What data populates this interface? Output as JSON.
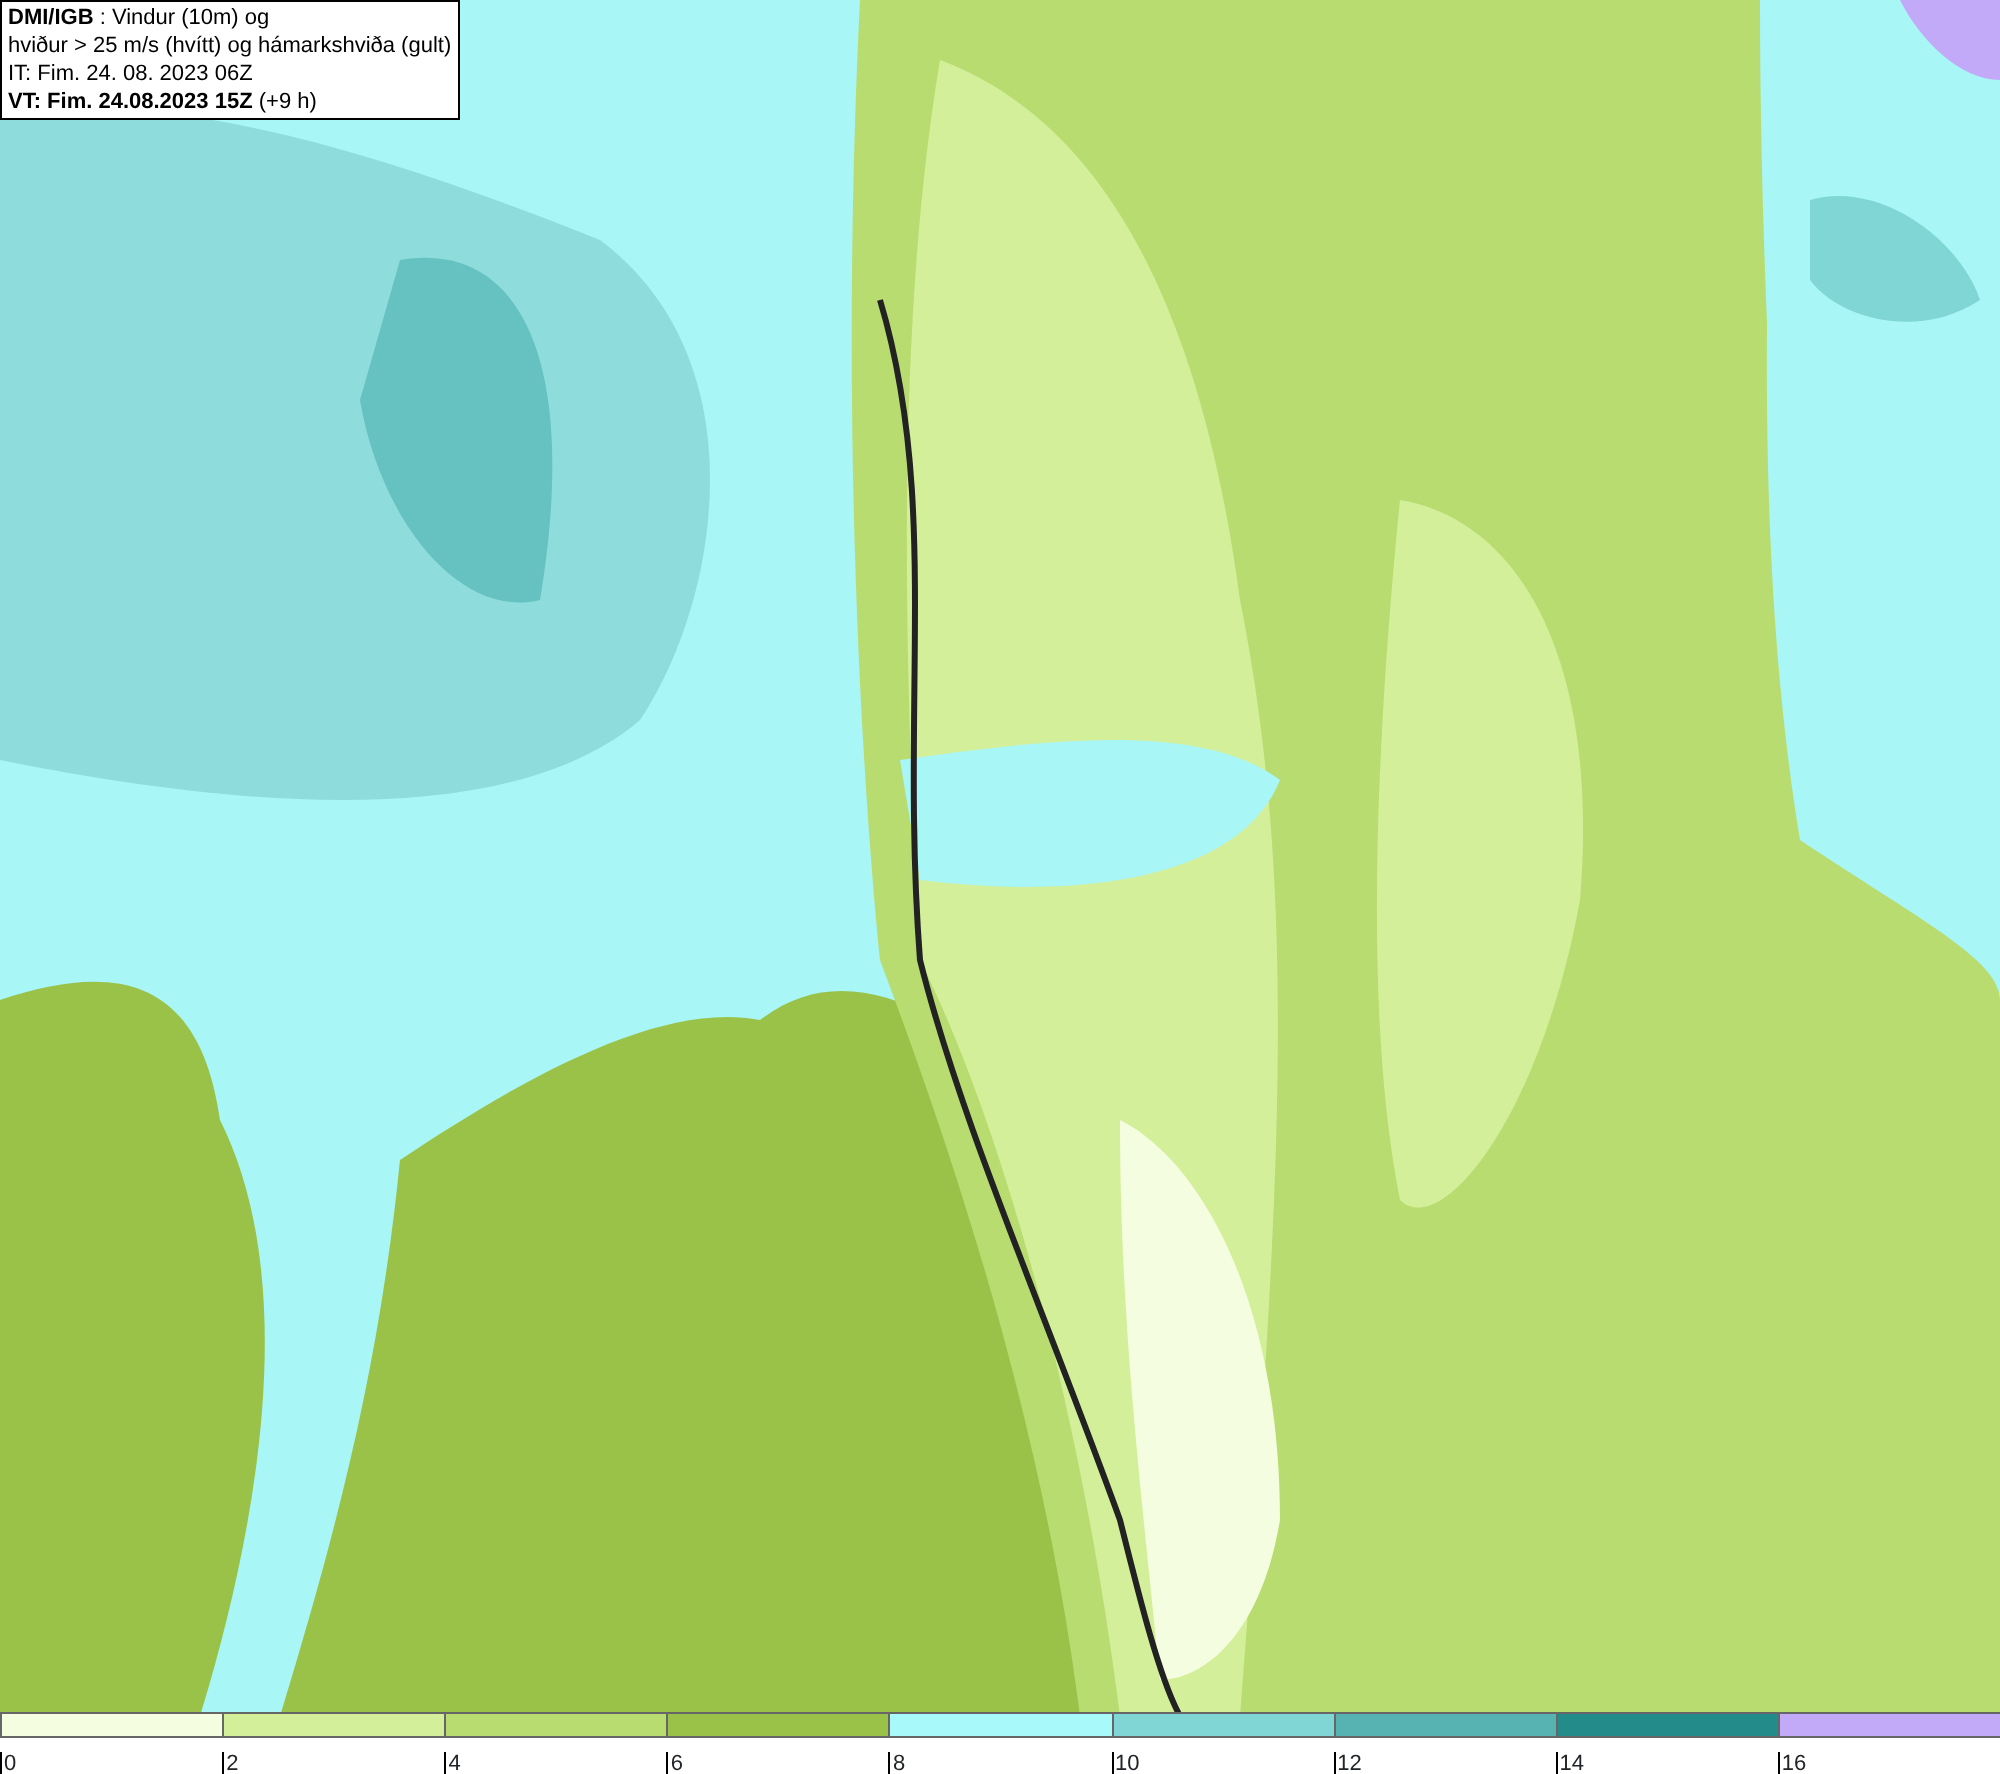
{
  "title_box": {
    "lines": [
      "**DMI/IGB** : Vindur (10m) og",
      "hviður > 25 m/s (hvítt) og hámarkshviða (gult)",
      "IT: Fim. 24. 08. 2023 06Z",
      "**VT: Fim. 24.08.2023 15Z** (+9 h)"
    ]
  },
  "legend": [
    {
      "label": "0",
      "color": "#f5fde0"
    },
    {
      "label": "2",
      "color": "#d4ef9a"
    },
    {
      "label": "4",
      "color": "#b8dc70"
    },
    {
      "label": "6",
      "color": "#9bc248"
    },
    {
      "label": "8",
      "color": "#a8fafa"
    },
    {
      "label": "10",
      "color": "#7fd6d4"
    },
    {
      "label": "12",
      "color": "#56b3b2"
    },
    {
      "label": "14",
      "color": "#238c8a"
    },
    {
      "label": "16",
      "color": "#c2aaf8"
    }
  ]
}
